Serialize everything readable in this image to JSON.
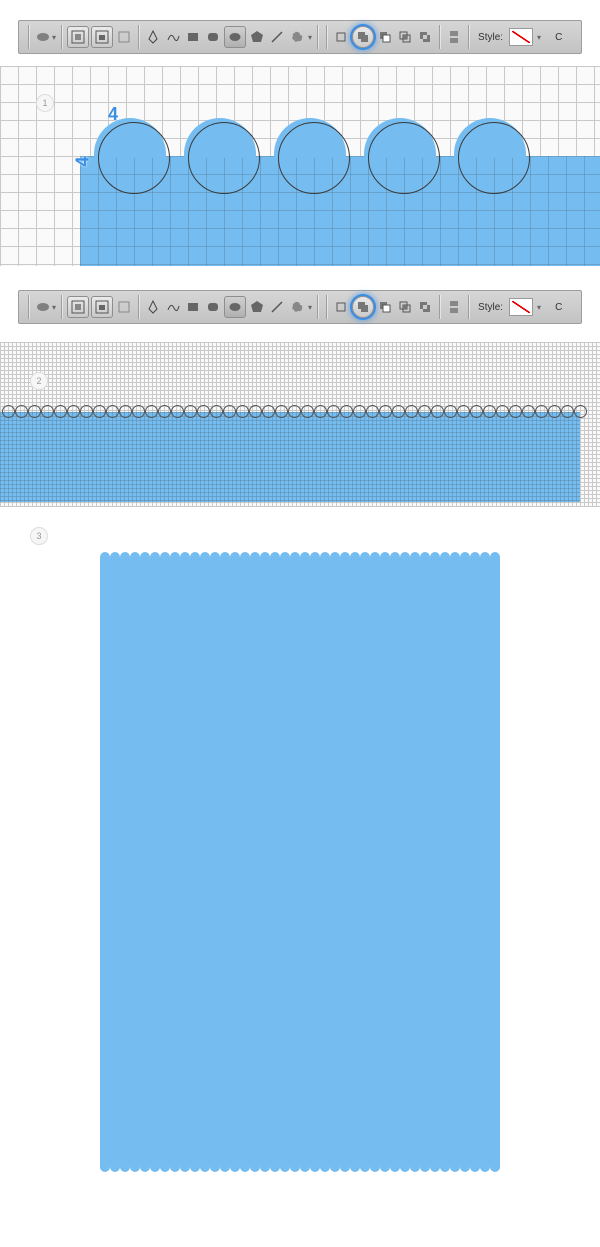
{
  "toolbar": {
    "style_label": "Style:",
    "tools": {
      "ellipse": "ellipse-tool",
      "shape_layers": "shape-layers",
      "paths": "paths",
      "fill_pixels": "fill-pixels",
      "pen": "pen",
      "freeform_pen": "freeform-pen",
      "rectangle": "rectangle",
      "rounded_rect": "rounded-rectangle",
      "ellipse_shape": "ellipse-shape",
      "polygon": "polygon",
      "line": "line",
      "custom_shape": "custom-shape",
      "new_layer": "new-shape-layer",
      "add_to": "add-to-shape-area",
      "subtract_from": "subtract-from-shape-area",
      "intersect": "intersect-shape-areas",
      "exclude": "exclude-overlapping",
      "geometry_options": "geometry-options"
    }
  },
  "steps": {
    "s1": "1",
    "s2": "2",
    "s3": "3"
  },
  "dimensions": {
    "top": "4",
    "side": "4"
  },
  "canvas": {
    "step1": {
      "circles": 5,
      "circle_diameter_cells": 4,
      "circle_spacing_cells": 5
    },
    "step2": {
      "circles": 45
    },
    "color": "#75bdf1"
  }
}
